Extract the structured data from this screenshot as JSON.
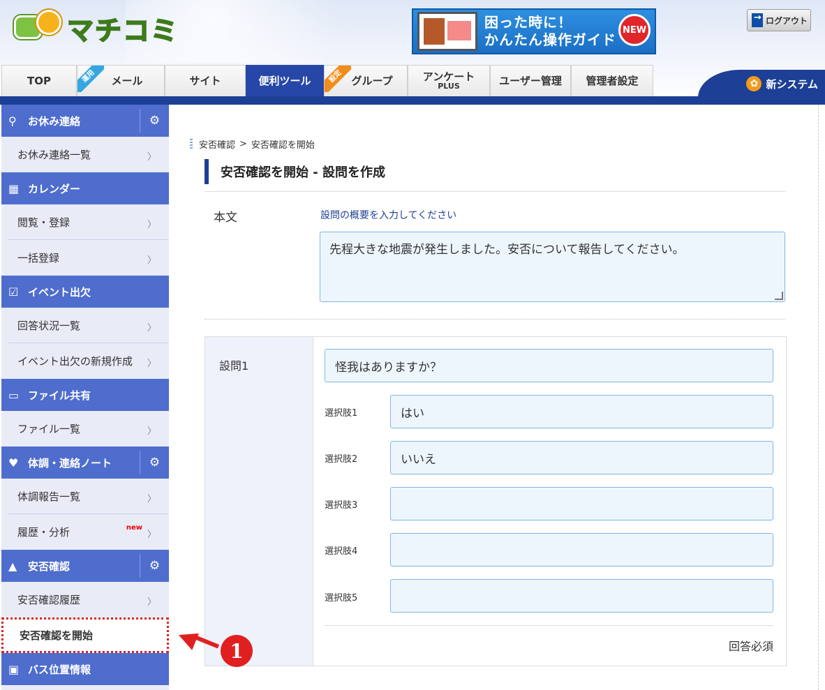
{
  "header": {
    "logo_text": "マチコミ",
    "banner_line1": "困った時に！",
    "banner_line2": "かんたん操作ガイド",
    "banner_badge": "NEW",
    "logout_label": "ログアウト",
    "new_system_label": "新システム"
  },
  "tabs": [
    {
      "label": "TOP",
      "sub": "",
      "ribbon": "",
      "active": false
    },
    {
      "label": "メール",
      "sub": "",
      "ribbon": "運用",
      "active": false
    },
    {
      "label": "サイト",
      "sub": "",
      "ribbon": "",
      "active": false
    },
    {
      "label": "便利ツール",
      "sub": "",
      "ribbon": "",
      "active": true
    },
    {
      "label": "グループ",
      "sub": "",
      "ribbon": "設定",
      "active": false
    },
    {
      "label": "アンケート",
      "sub": "PLUS",
      "ribbon": "",
      "active": false
    },
    {
      "label": "ユーザー管理",
      "sub": "",
      "ribbon": "",
      "active": false
    },
    {
      "label": "管理者設定",
      "sub": "",
      "ribbon": "",
      "active": false
    }
  ],
  "sidebar": {
    "sections": [
      {
        "title": "お休み連絡",
        "icon": "person-check-icon",
        "has_settings": true,
        "items": [
          {
            "label": "お休み連絡一覧"
          }
        ]
      },
      {
        "title": "カレンダー",
        "icon": "calendar-icon",
        "has_settings": false,
        "items": [
          {
            "label": "閲覧・登録"
          },
          {
            "label": "一括登録"
          }
        ]
      },
      {
        "title": "イベント出欠",
        "icon": "calendar-check-icon",
        "has_settings": false,
        "items": [
          {
            "label": "回答状況一覧"
          },
          {
            "label": "イベント出欠の新規作成"
          }
        ]
      },
      {
        "title": "ファイル共有",
        "icon": "folder-icon",
        "has_settings": false,
        "items": [
          {
            "label": "ファイル一覧"
          }
        ]
      },
      {
        "title": "体調・連絡ノート",
        "icon": "heartbeat-icon",
        "has_settings": true,
        "items": [
          {
            "label": "体調報告一覧"
          },
          {
            "label": "履歴・分析",
            "badge": "new"
          }
        ]
      },
      {
        "title": "安否確認",
        "icon": "warning-icon",
        "has_settings": true,
        "items": [
          {
            "label": "安否確認履歴"
          },
          {
            "label": "安否確認を開始",
            "current": true
          }
        ]
      },
      {
        "title": "バス位置情報",
        "icon": "bus-icon",
        "has_settings": false,
        "items": []
      }
    ]
  },
  "breadcrumb": {
    "parent": "安否確認",
    "separator": ">",
    "current": "安否確認を開始"
  },
  "page_title": "安否確認を開始 - 設問を作成",
  "form": {
    "body_label": "本文",
    "body_hint": "設問の概要を入力してください",
    "body_value": "先程大きな地震が発生しました。安否について報告してください。",
    "question_label": "設問1",
    "question_value": "怪我はありますか？",
    "options": [
      {
        "label": "選択肢1",
        "value": "はい"
      },
      {
        "label": "選択肢2",
        "value": "いいえ"
      },
      {
        "label": "選択肢3",
        "value": ""
      },
      {
        "label": "選択肢4",
        "value": ""
      },
      {
        "label": "選択肢5",
        "value": ""
      }
    ],
    "required_label": "回答必須"
  },
  "annotation": {
    "number": "1",
    "color": "#e02020"
  }
}
